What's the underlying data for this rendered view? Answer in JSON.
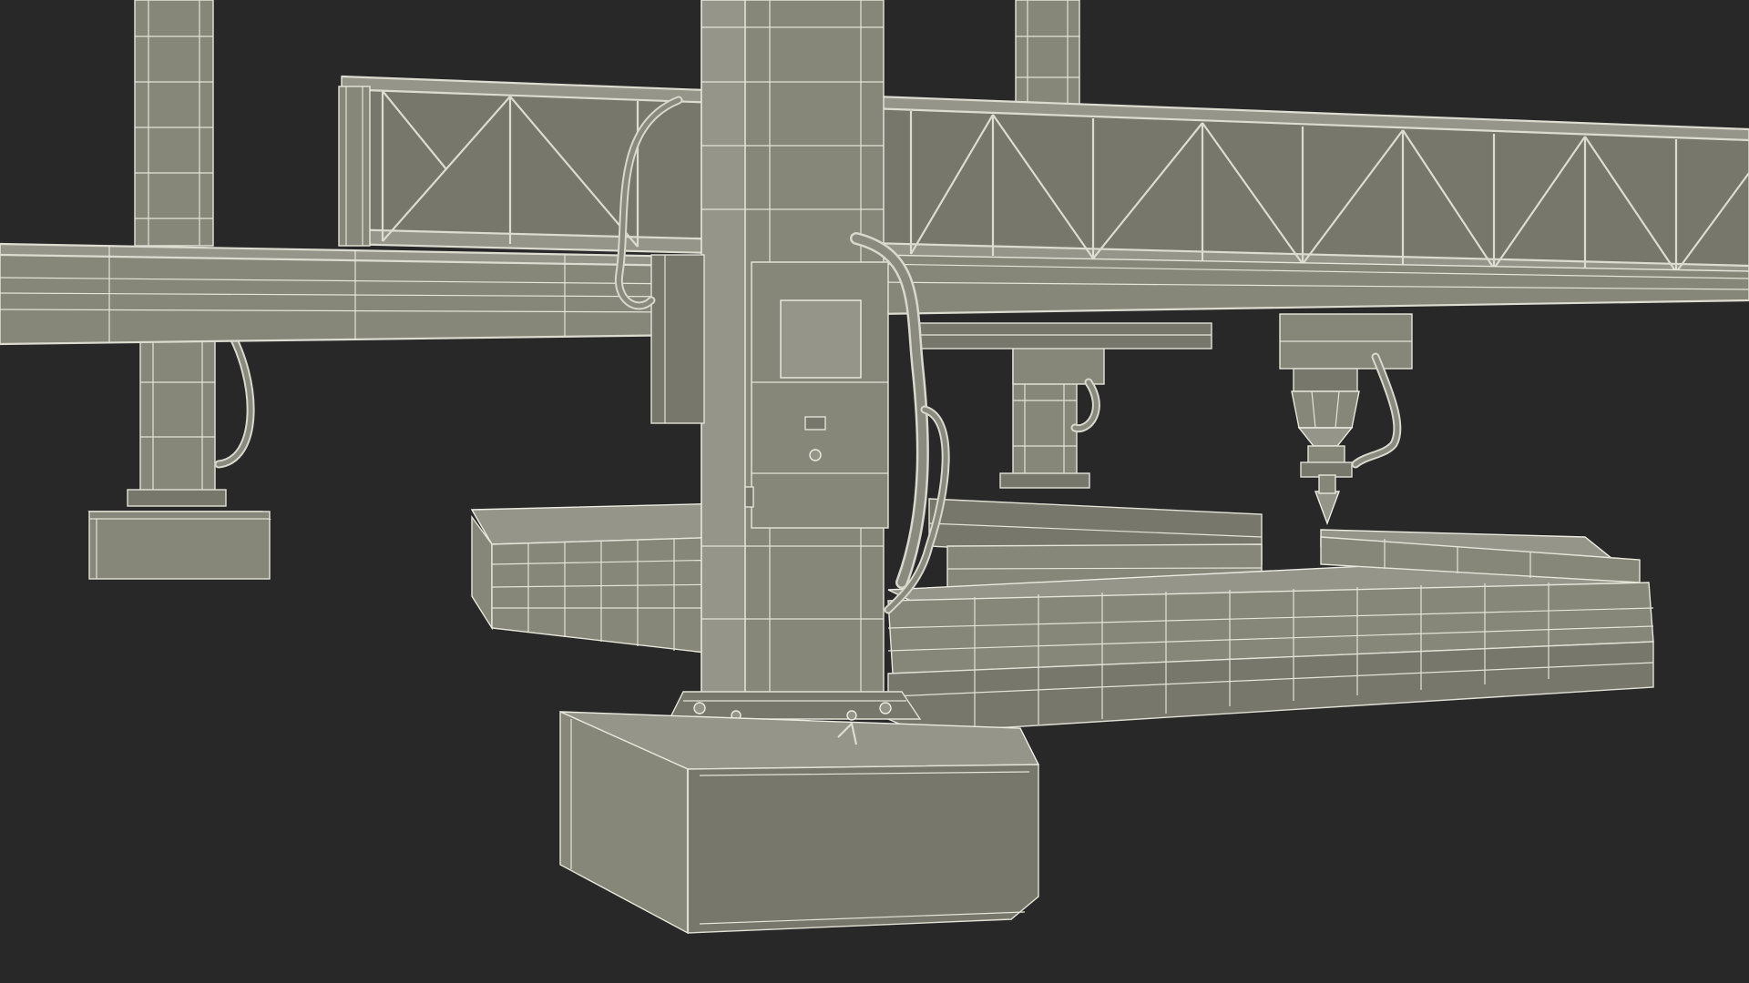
{
  "scene": {
    "subject": "3d-printer-gantry-wireframe",
    "colors": {
      "background": "#282828",
      "material": "#868679",
      "wireframe": "#e6e6da"
    }
  }
}
